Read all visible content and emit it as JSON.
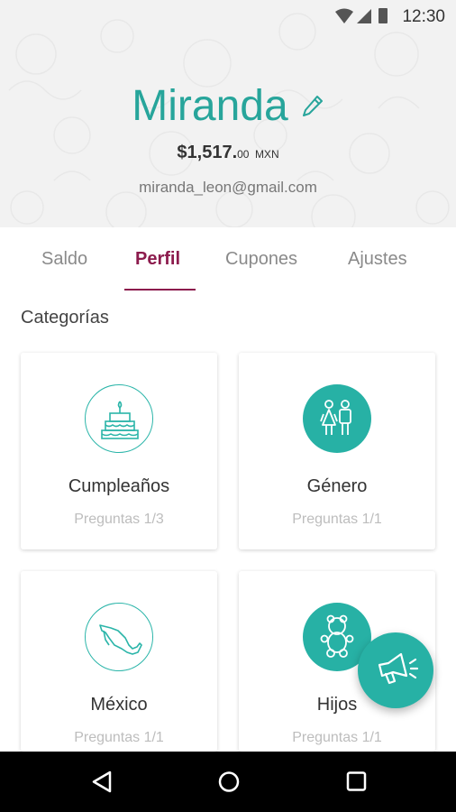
{
  "status_bar": {
    "time": "12:30",
    "icons": [
      "wifi-icon",
      "cell-signal-icon",
      "battery-icon"
    ]
  },
  "profile": {
    "name": "Miranda",
    "balance_amount": "$1,517.",
    "balance_cents": "00",
    "balance_currency": "MXN",
    "email": "miranda_leon@gmail.com",
    "edit_icon": "pencil-icon"
  },
  "tabs": [
    {
      "label": "Saldo",
      "active": false
    },
    {
      "label": "Perfil",
      "active": true
    },
    {
      "label": "Cupones",
      "active": false
    },
    {
      "label": "Ajustes",
      "active": false
    }
  ],
  "section": {
    "title": "Categorías"
  },
  "cards": [
    {
      "title": "Cumpleaños",
      "subtitle": "Preguntas 1/3",
      "icon": "cake-icon",
      "completed": false
    },
    {
      "title": "Género",
      "subtitle": "Preguntas 1/1",
      "icon": "people-icon",
      "completed": true
    },
    {
      "title": "México",
      "subtitle": "Preguntas 1/1",
      "icon": "mexico-map-icon",
      "completed": false
    },
    {
      "title": "Hijos",
      "subtitle": "Preguntas 1/1",
      "icon": "teddy-bear-icon",
      "completed": true
    }
  ],
  "fab": {
    "icon": "megaphone-icon"
  },
  "nav": {
    "back": "back-icon",
    "home": "home-icon",
    "recents": "recents-icon"
  },
  "colors": {
    "accent": "#27b1a5",
    "tab_active": "#8c1b4d",
    "header_bg": "#f2f2f2"
  }
}
